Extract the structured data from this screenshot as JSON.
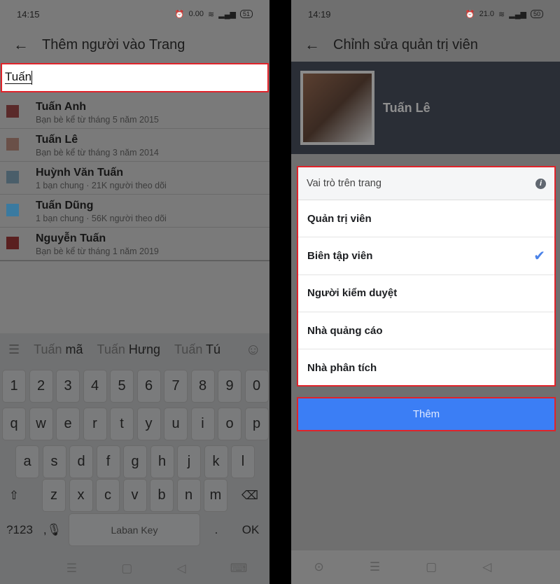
{
  "left": {
    "status": {
      "time": "14:15",
      "speed": "0.00",
      "battery": "51"
    },
    "title": "Thêm người vào Trang",
    "search_value": "Tuấn",
    "results": [
      {
        "name": "Tuấn Anh",
        "sub": "Bạn bè kể từ tháng 5 năm 2015",
        "color": "#5a2a2a"
      },
      {
        "name": "Tuấn Lê",
        "sub": "Bạn bè kể từ tháng 3 năm 2014",
        "color": "#6a5048"
      },
      {
        "name": "Huỳnh Văn Tuấn",
        "sub": "1 bạn chung · 21K người theo dõi",
        "color": "#4a5e6a"
      },
      {
        "name": "Tuấn Dũng",
        "sub": "1 bạn chung · 56K người theo dõi",
        "color": "#3a7aa0"
      },
      {
        "name": "Nguyễn Tuấn",
        "sub": "Bạn bè kể từ tháng 1 năm 2019",
        "color": "#5a2020"
      }
    ],
    "keyboard": {
      "suggestions": [
        {
          "a": "Tuấn",
          "b": "mã"
        },
        {
          "a": "Tuấn",
          "b": "Hưng"
        },
        {
          "a": "Tuấn",
          "b": "Tú"
        }
      ],
      "rows": [
        [
          "1",
          "2",
          "3",
          "4",
          "5",
          "6",
          "7",
          "8",
          "9",
          "0"
        ],
        [
          "q",
          "w",
          "e",
          "r",
          "t",
          "y",
          "u",
          "i",
          "o",
          "p"
        ],
        [
          "a",
          "s",
          "d",
          "f",
          "g",
          "h",
          "j",
          "k",
          "l"
        ],
        [
          "⇧",
          "z",
          "x",
          "c",
          "v",
          "b",
          "n",
          "m",
          "⌫"
        ]
      ],
      "symbols": "?123",
      "comma": ",🎙",
      "space": "Laban Key",
      "period": ".",
      "ok": "OK"
    }
  },
  "right": {
    "status": {
      "time": "14:19",
      "speed": "21.0",
      "battery": "50"
    },
    "title": "Chỉnh sửa quản trị viên",
    "profile_name": "Tuấn Lê",
    "roles_header": "Vai trò trên trang",
    "roles": [
      {
        "label": "Quản trị viên",
        "selected": false
      },
      {
        "label": "Biên tập viên",
        "selected": true
      },
      {
        "label": "Người kiểm duyệt",
        "selected": false
      },
      {
        "label": "Nhà quảng cáo",
        "selected": false
      },
      {
        "label": "Nhà phân tích",
        "selected": false
      }
    ],
    "add_button": "Thêm",
    "accent": "#3b7ef5"
  }
}
